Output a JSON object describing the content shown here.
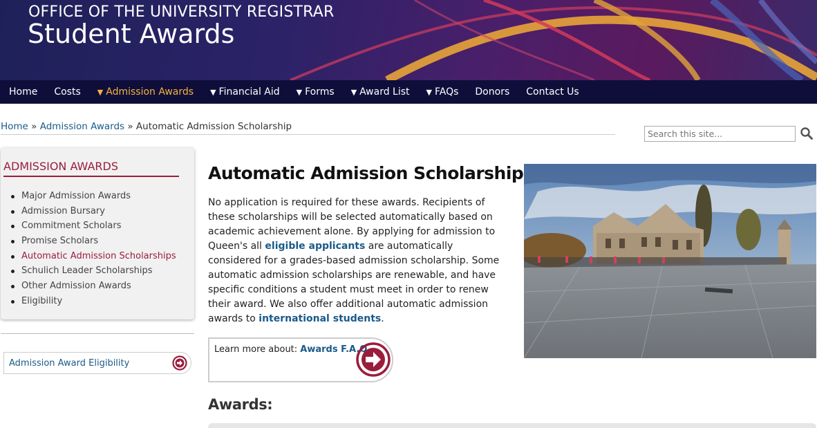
{
  "header": {
    "office": "OFFICE OF THE UNIVERSITY REGISTRAR",
    "title": "Student Awards"
  },
  "nav": {
    "items": [
      {
        "label": "Home",
        "dropdown": false
      },
      {
        "label": "Costs",
        "dropdown": false
      },
      {
        "label": "Admission Awards",
        "dropdown": true,
        "active": true
      },
      {
        "label": "Financial Aid",
        "dropdown": true
      },
      {
        "label": "Forms",
        "dropdown": true
      },
      {
        "label": "Award List",
        "dropdown": true
      },
      {
        "label": "FAQs",
        "dropdown": true
      },
      {
        "label": "Donors",
        "dropdown": false
      },
      {
        "label": "Contact Us",
        "dropdown": false
      }
    ]
  },
  "breadcrumb": {
    "home": "Home",
    "sep": "»",
    "section": "Admission Awards",
    "current": "Automatic Admission Scholarship"
  },
  "search": {
    "placeholder": "Search this site..."
  },
  "sidebar": {
    "title": "ADMISSION AWARDS",
    "items": [
      "Major Admission Awards",
      "Admission Bursary",
      "Commitment Scholars",
      "Promise Scholars",
      "Automatic Admission Scholarships",
      "Schulich Leader Scholarships",
      "Other Admission Awards",
      "Eligibility"
    ],
    "eligibility_link": "Admission Award Eligibility"
  },
  "main": {
    "title": "Automatic Admission Scholarships",
    "para_1": "No application is required for these awards. Recipients of these scholarships will be selected automatically based on academic achievement alone. By applying for admission to Queen's all ",
    "link_1": "eligible applicants",
    "para_2": " are automatically considered for a grades-based admission scholarship. Some automatic admission scholarships are renewable, and have specific conditions a student must meet in order to renew their award. We also offer additional automatic admission awards to ",
    "link_2": "international students",
    "para_end": ".",
    "learn_prefix": "Learn more about: ",
    "learn_link": "Awards F.A.Q",
    "awards_heading": "Awards:"
  },
  "colors": {
    "nav_bg": "#0f0e3b",
    "accent_gold": "#f4b43c",
    "accent_maroon": "#9a1d3b",
    "link_blue": "#1a5a8a"
  }
}
